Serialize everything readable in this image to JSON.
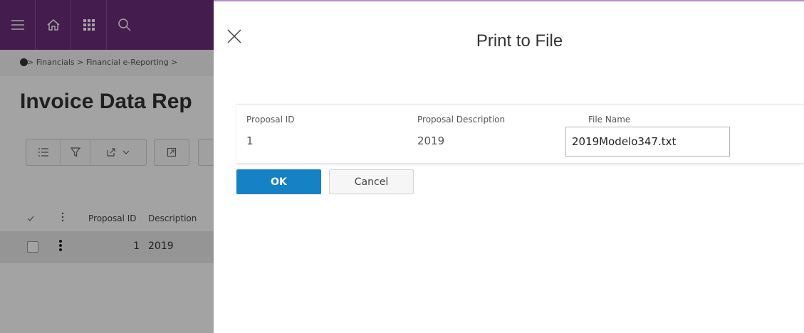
{
  "background": {
    "breadcrumb": "> Financials > Financial e-Reporting >",
    "page_title": "Invoice Data Rep",
    "list": {
      "columns": [
        "Proposal ID",
        "Description"
      ],
      "rows": [
        {
          "proposal_id": "1",
          "description": "2019"
        }
      ]
    }
  },
  "dialog": {
    "title": "Print to File",
    "fields": {
      "proposal_id": {
        "label": "Proposal ID",
        "value": "1"
      },
      "proposal_description": {
        "label": "Proposal Description",
        "value": "2019"
      },
      "file_name": {
        "label": "File Name",
        "value": "2019Modelo347.txt"
      }
    },
    "buttons": {
      "ok": "OK",
      "cancel": "Cancel"
    }
  },
  "colors": {
    "topbar": "#6b2c79",
    "primary_button": "#1482c4",
    "dialog_accent": "#b48ec3"
  },
  "icons": [
    "hamburger-menu-icon",
    "home-icon",
    "apps-grid-icon",
    "search-icon",
    "close-icon",
    "list-icon",
    "filter-icon",
    "export-icon",
    "chevron-down-icon",
    "open-in-icon",
    "more-vertical-icon",
    "check-icon"
  ]
}
